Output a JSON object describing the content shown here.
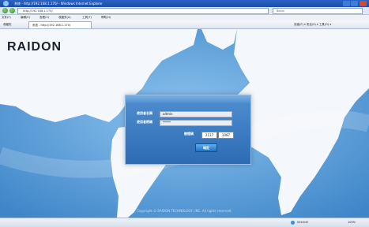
{
  "window": {
    "title": "系统 - http://192.168.1.170/ - Windows Internet Explorer"
  },
  "address_bar": {
    "url": "http://192.168.1.170/",
    "search_placeholder": "Baidu"
  },
  "menu": {
    "items": [
      "文件(F)",
      "编辑(E)",
      "查看(V)",
      "收藏夹(A)",
      "工具(T)",
      "帮助(H)"
    ]
  },
  "favorites": {
    "label": "收藏夹",
    "tab": "系统 - http://192.168.1.170/",
    "right_tools": "页面(P) ▾   安全(S) ▾   工具(O) ▾"
  },
  "brand": {
    "logo": "RAIDON"
  },
  "login": {
    "username_label": "使用者名稱",
    "username_value": "admin",
    "password_label": "使用者密碼",
    "password_value": "*****",
    "captcha_label": "驗證碼",
    "captcha_input": "2117",
    "captcha_code": "1087",
    "submit_label": "確定"
  },
  "footer": {
    "copyright": "Copyright © RAIDON TECHNOLOGY, INC. All rights reserved."
  },
  "status": {
    "zone": "Internet",
    "zoom": "100%"
  }
}
